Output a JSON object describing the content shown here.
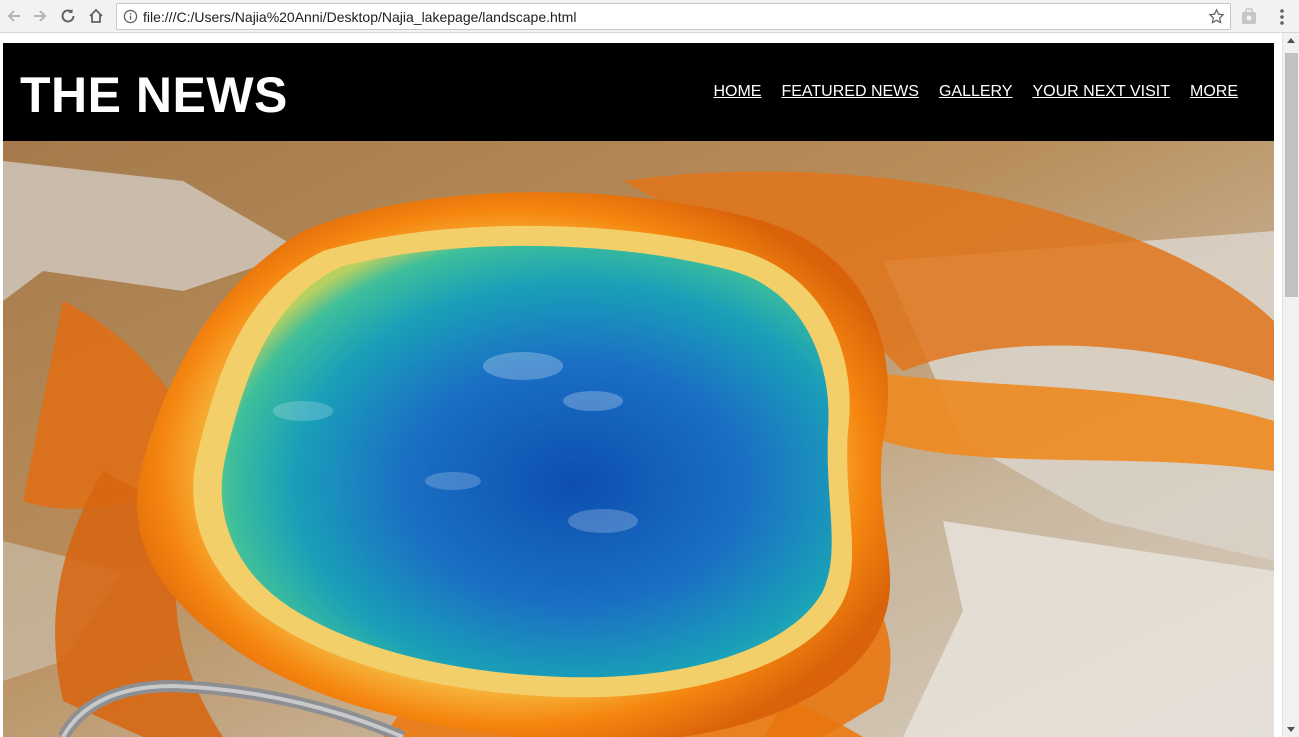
{
  "browser": {
    "back_icon": "arrow-left-icon",
    "forward_icon": "arrow-right-icon",
    "reload_icon": "reload-icon",
    "home_icon": "home-icon",
    "info_icon": "info-icon",
    "url": "file:///C:/Users/Najia%20Anni/Desktop/Najia_lakepage/landscape.html",
    "bookmark_icon": "star-icon",
    "extension_icon": "extension-icon",
    "menu_icon": "vertical-dots-icon"
  },
  "site": {
    "title": "THE NEWS",
    "nav": [
      "HOME",
      "FEATURED NEWS",
      "GALLERY",
      "YOUR NEXT VISIT",
      "MORE"
    ]
  },
  "hero": {
    "description": "aerial-hot-spring-photo"
  },
  "colors": {
    "header_bg": "#000000",
    "header_text": "#ffffff",
    "spring_blue": "#1f6fc0",
    "spring_orange": "#f07a10"
  }
}
